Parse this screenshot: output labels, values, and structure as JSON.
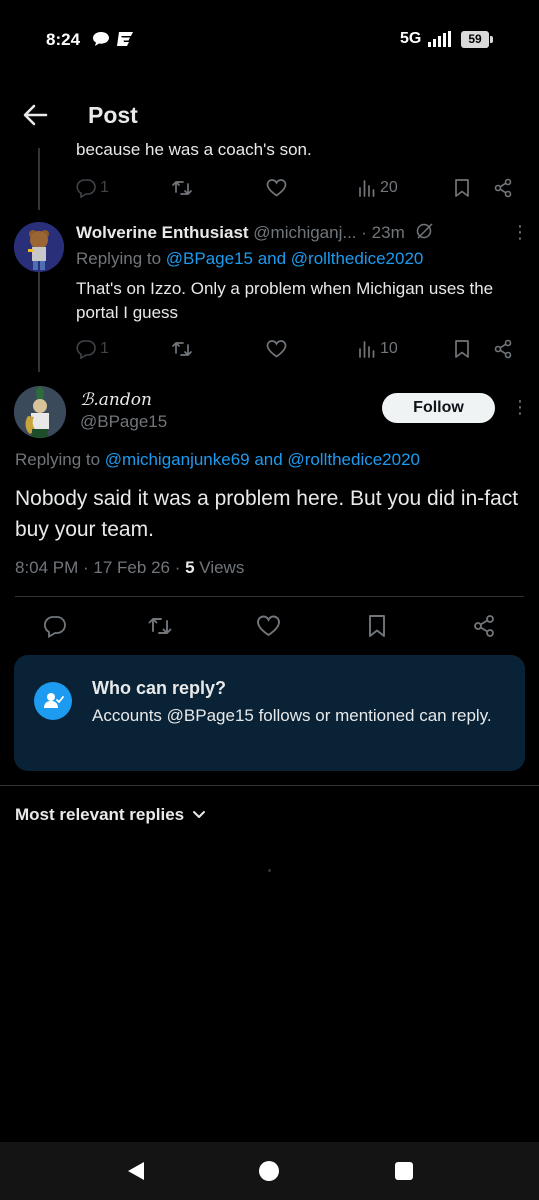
{
  "status_bar": {
    "time": "8:24",
    "network": "5G",
    "battery": "59"
  },
  "header": {
    "title": "Post"
  },
  "thread": {
    "partial_text": "because he was a coach's son.",
    "parent_actions": {
      "replies": "1",
      "views": "20"
    },
    "reply": {
      "display_name": "Wolverine Enthusiast",
      "handle": "@michiganj...",
      "time": "· 23m",
      "replying_prefix": "Replying to ",
      "replying_to": "@BPage15 and @rollthedice2020",
      "text": "That's on Izzo. Only a problem when Michigan uses the portal I guess",
      "actions": {
        "replies": "1",
        "views": "10"
      }
    }
  },
  "main_post": {
    "display_name": "ℬ.andon",
    "handle": "@BPage15",
    "follow_label": "Follow",
    "replying_prefix": "Replying to ",
    "replying_to": "@michiganjunke69 and @rollthedice2020",
    "text": "Nobody said it was a problem here. But you did in-fact buy your team.",
    "timestamp": "8:04 PM · 17 Feb 26 · ",
    "views_count": "5",
    "views_label": " Views"
  },
  "who_can_reply": {
    "title": "Who can reply?",
    "text": "Accounts @BPage15 follows or mentioned can reply."
  },
  "sort": {
    "label": "Most relevant replies"
  },
  "colors": {
    "accent": "#1d9bf0",
    "background": "#000000",
    "muted": "#71767b",
    "card": "#0a2235"
  }
}
